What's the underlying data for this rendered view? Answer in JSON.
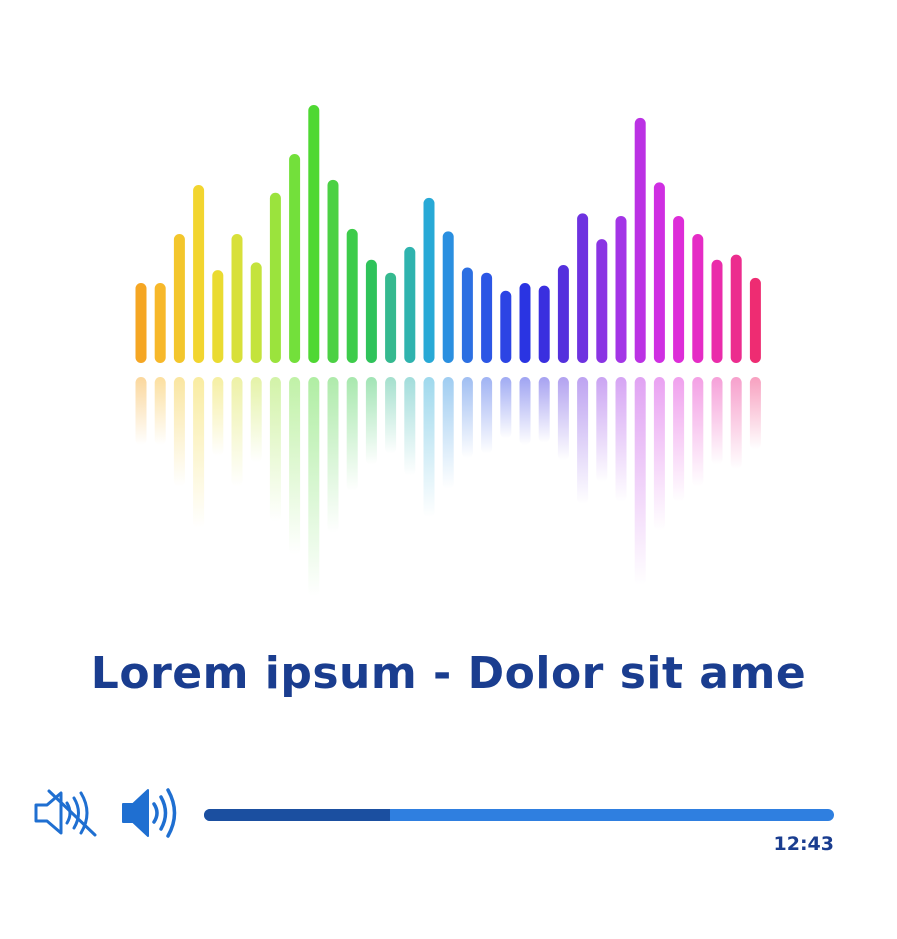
{
  "player": {
    "track_title": "Lorem ipsum - Dolor sit ame",
    "time": "12:43",
    "progress": 0.295
  },
  "icons": {
    "mute": "speaker-muted-icon",
    "volume": "speaker-volume-icon"
  },
  "visualizer": {
    "levels": [
      0.31,
      0.31,
      0.5,
      0.69,
      0.36,
      0.5,
      0.39,
      0.66,
      0.81,
      1.0,
      0.71,
      0.52,
      0.4,
      0.35,
      0.45,
      0.64,
      0.51,
      0.37,
      0.35,
      0.28,
      0.31,
      0.3,
      0.38,
      0.58,
      0.48,
      0.57,
      0.95,
      0.7,
      0.57,
      0.5,
      0.4,
      0.42,
      0.33
    ],
    "colors": [
      "#f5a623",
      "#f7b82a",
      "#f3c62c",
      "#f2d52f",
      "#eadb31",
      "#d8e03a",
      "#c4e33c",
      "#9be33d",
      "#73e03b",
      "#4fd833",
      "#4cd144",
      "#3dcc4a",
      "#2fc35a",
      "#35b98f",
      "#2fb3ae",
      "#28a9d6",
      "#2a8fe0",
      "#2c6fe2",
      "#2c56e5",
      "#2c44e4",
      "#2a34e2",
      "#3a2fdf",
      "#5430dd",
      "#6e32e0",
      "#8a34e3",
      "#a335e6",
      "#bb32e4",
      "#cf2fe2",
      "#dd2dd8",
      "#e52cc5",
      "#ea2caa",
      "#ec2c8e",
      "#ee2c72"
    ]
  },
  "colors": {
    "title": "#1a3d8f",
    "track": "#2f7fe0",
    "track_fill": "#1b4fa0"
  }
}
